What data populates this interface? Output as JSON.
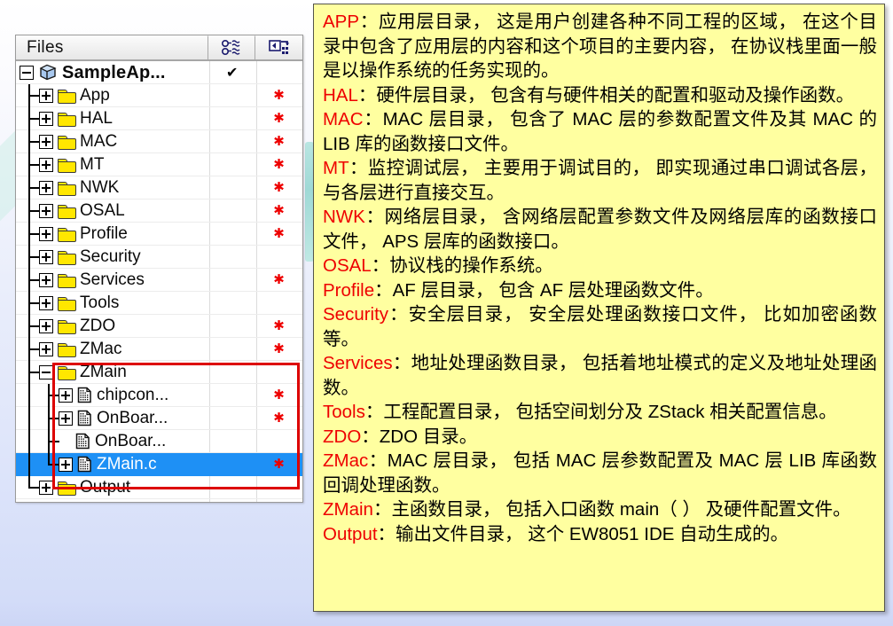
{
  "files_panel": {
    "header": {
      "title": "Files",
      "icon1": "link-nodes-icon",
      "icon2": "make-target-icon"
    },
    "root": {
      "label": "SampleAp...",
      "status": "✔",
      "expander": "minus"
    },
    "rows": [
      {
        "label": "App",
        "type": "folder",
        "expander": "plus",
        "depth": 1,
        "star": true,
        "check": ""
      },
      {
        "label": "HAL",
        "type": "folder",
        "expander": "plus",
        "depth": 1,
        "star": true,
        "check": ""
      },
      {
        "label": "MAC",
        "type": "folder",
        "expander": "plus",
        "depth": 1,
        "star": true,
        "check": ""
      },
      {
        "label": "MT",
        "type": "folder",
        "expander": "plus",
        "depth": 1,
        "star": true,
        "check": ""
      },
      {
        "label": "NWK",
        "type": "folder",
        "expander": "plus",
        "depth": 1,
        "star": true,
        "check": ""
      },
      {
        "label": "OSAL",
        "type": "folder",
        "expander": "plus",
        "depth": 1,
        "star": true,
        "check": ""
      },
      {
        "label": "Profile",
        "type": "folder",
        "expander": "plus",
        "depth": 1,
        "star": true,
        "check": ""
      },
      {
        "label": "Security",
        "type": "folder",
        "expander": "plus",
        "depth": 1,
        "star": false,
        "check": ""
      },
      {
        "label": "Services",
        "type": "folder",
        "expander": "plus",
        "depth": 1,
        "star": true,
        "check": ""
      },
      {
        "label": "Tools",
        "type": "folder",
        "expander": "plus",
        "depth": 1,
        "star": false,
        "check": ""
      },
      {
        "label": "ZDO",
        "type": "folder",
        "expander": "plus",
        "depth": 1,
        "star": true,
        "check": ""
      },
      {
        "label": "ZMac",
        "type": "folder",
        "expander": "plus",
        "depth": 1,
        "star": true,
        "check": ""
      },
      {
        "label": "ZMain",
        "type": "folder",
        "expander": "minus",
        "depth": 1,
        "star": false,
        "check": ""
      },
      {
        "label": "chipcon...",
        "type": "file",
        "expander": "plus",
        "depth": 2,
        "star": true,
        "check": ""
      },
      {
        "label": "OnBoar...",
        "type": "file",
        "expander": "plus",
        "depth": 2,
        "star": true,
        "check": ""
      },
      {
        "label": "OnBoar...",
        "type": "file",
        "expander": "none",
        "depth": 2,
        "star": false,
        "check": ""
      },
      {
        "label": "ZMain.c",
        "type": "file",
        "expander": "plus",
        "depth": 2,
        "star": true,
        "check": "",
        "selected": true
      },
      {
        "label": "Output",
        "type": "folder",
        "expander": "plus",
        "depth": 1,
        "star": false,
        "check": ""
      }
    ],
    "highlight_color": "#dd0000",
    "selection_color": "#1e90f5",
    "star_color": "#ee0000"
  },
  "note": {
    "background_color": "#ffffa0",
    "term_color": "#ee0000",
    "lines": [
      {
        "term": "APP",
        "text": "：应用层目录， 这是用户创建各种不同工程的区域， 在这个目录中包含了应用层的内容和这个项目的主要内容， 在协议栈里面一般是以操作系统的任务实现的。"
      },
      {
        "term": "HAL",
        "text": "：硬件层目录， 包含有与硬件相关的配置和驱动及操作函数。"
      },
      {
        "term": "MAC",
        "text": "：MAC 层目录， 包含了 MAC 层的参数配置文件及其 MAC 的 LIB 库的函数接口文件。"
      },
      {
        "term": "MT",
        "text": "：监控调试层， 主要用于调试目的， 即实现通过串口调试各层，与各层进行直接交互。"
      },
      {
        "term": "NWK",
        "text": "：网络层目录， 含网络层配置参数文件及网络层库的函数接口文件， APS 层库的函数接口。"
      },
      {
        "term": "OSAL",
        "text": "：协议栈的操作系统。"
      },
      {
        "term": "Profile",
        "text": "：AF 层目录， 包含 AF 层处理函数文件。"
      },
      {
        "term": "Security",
        "text": "：安全层目录， 安全层处理函数接口文件， 比如加密函数等。"
      },
      {
        "term": "Services",
        "text": "：地址处理函数目录， 包括着地址模式的定义及地址处理函数。"
      },
      {
        "term": "Tools",
        "text": "：工程配置目录， 包括空间划分及 ZStack 相关配置信息。"
      },
      {
        "term": "ZDO",
        "text": "：ZDO 目录。"
      },
      {
        "term": "ZMac",
        "text": "：MAC 层目录， 包括 MAC 层参数配置及 MAC 层 LIB 库函数回调处理函数。"
      },
      {
        "term": "ZMain",
        "text": "：主函数目录， 包括入口函数 main（ ） 及硬件配置文件。"
      },
      {
        "term": "Output",
        "text": "：输出文件目录， 这个 EW8051 IDE 自动生成的。"
      }
    ]
  }
}
